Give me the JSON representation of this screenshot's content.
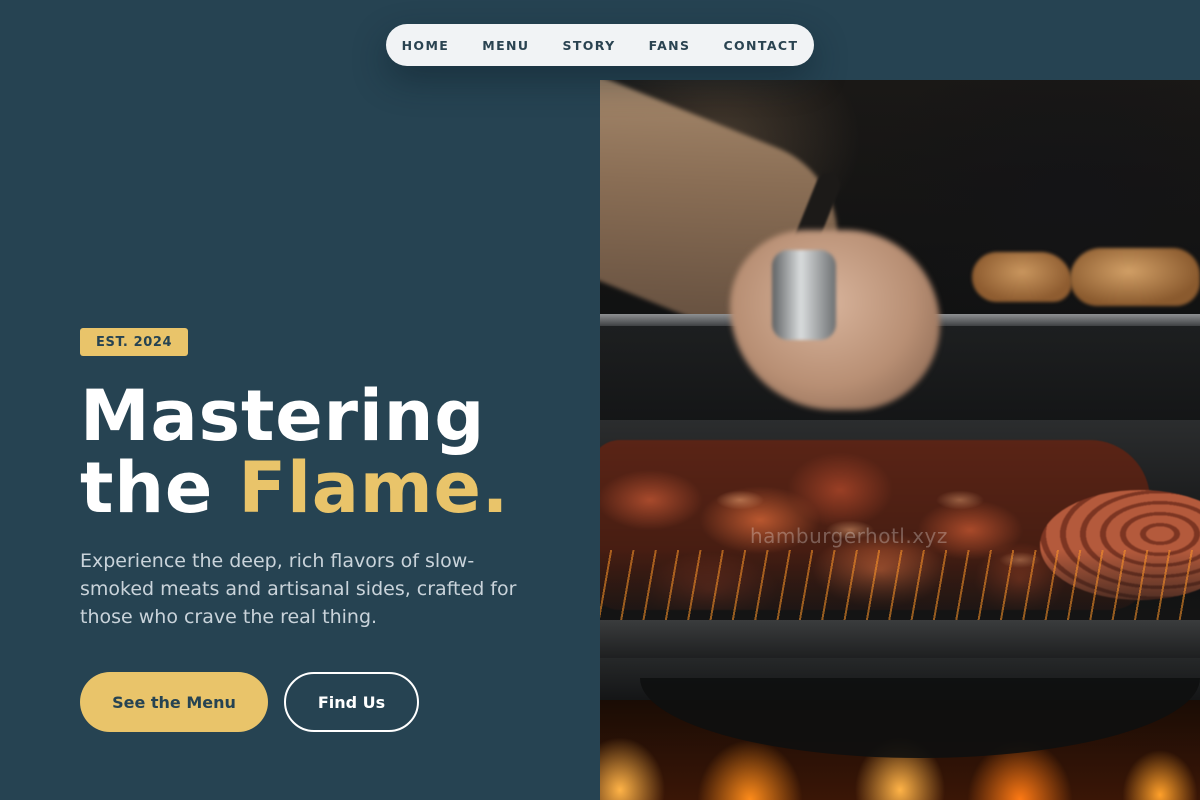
{
  "nav": {
    "items": [
      "HOME",
      "MENU",
      "STORY",
      "FANS",
      "CONTACT"
    ]
  },
  "hero": {
    "badge": "EST. 2024",
    "headline_line1": "Mastering",
    "headline_line2_prefix": "the",
    "headline_line2_accent": "Flame.",
    "lead": "Experience the deep, rich flavors of slow-smoked meats and artisanal sides, crafted for those who crave the real thing.",
    "cta_primary": "See the Menu",
    "cta_secondary": "Find Us",
    "image_watermark": "hamburgerhotl.xyz"
  },
  "colors": {
    "background": "#264352",
    "accent": "#e9c46a",
    "nav_bg": "#f1f3f5",
    "text_primary": "#ffffff",
    "text_muted": "#c9d3da"
  },
  "icons": []
}
